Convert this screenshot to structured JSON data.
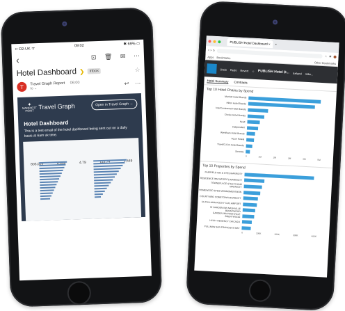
{
  "left_phone": {
    "status_bar": {
      "carrier": "•• O2-UK ᯤ",
      "time": "09:02",
      "battery": "✱ 69% ▭"
    },
    "toolbar": {
      "back": "‹",
      "archive": "⊡",
      "delete": "🗑",
      "mail": "✉",
      "more": "⋯"
    },
    "subject": "Hotel Dashboard",
    "label": "Inbox",
    "sender": {
      "initial": "T",
      "name": "Travel Graph Report",
      "time": "06:00",
      "to": "to ⌄"
    },
    "banner": {
      "logo_text": "MARRIOTT\nPOINT",
      "brand": "Travel Graph",
      "open_button": "Open in Travel Graph →",
      "heading": "Hotel Dashboard",
      "body": "This is a test email of the hotel dashboard being sent out on a daily basis at 6am uk time."
    },
    "kpis": [
      "803,024",
      "6,558",
      "4.79",
      "115.74",
      "1,449"
    ]
  },
  "right_phone": {
    "browser": {
      "tab_title": "PUBLISH Hotel Dashboard",
      "close": "×",
      "new_tab": "+",
      "address": "< > ↻",
      "apps": "Apps",
      "bookmarks": "Bookmarks",
      "other_bookmarks": "Other Bookmarks"
    },
    "app_bar": {
      "undo": "Undo",
      "redo": "Redo",
      "revert": "Revert",
      "title": "PUBLISH Hotel D...",
      "loc": "Iceland",
      "user": "mike..."
    },
    "tabs": [
      "Hotel Summary",
      "Contracts"
    ],
    "chart1_title": "Top 10 Hotel Chains by Spend",
    "chart2_title": "Top 10 Properties by Spend"
  },
  "chart_data": [
    {
      "type": "bar",
      "title": "Top 10 Hotel Chains by Spend",
      "categories": [
        "Marriott Hotel Brands",
        "Hilton Hotel Brands",
        "InterContinental Hotel Brands",
        "Choice Hotel Brands",
        "Hyatt",
        "Independent",
        "Wyndham Hotel Brands",
        "Accor Hotels",
        "TravelCLICK Hotel Brands",
        "Sonesta"
      ],
      "values": [
        5.0,
        4.6,
        1.4,
        1.15,
        0.85,
        0.75,
        0.6,
        0.55,
        0.42,
        0.3
      ],
      "xticks": [
        "0",
        "1M",
        "2M",
        "3M",
        "4M",
        "5M"
      ],
      "xlim": [
        0,
        5.2
      ]
    },
    {
      "type": "bar",
      "title": "Top 10 Properties by Spend",
      "categories": [
        "FAIRFIELD INN & STES MARRIOTT",
        "RESIDENCE INN WATERTS MARRIOTT",
        "TOWNEPLACE STES THUNB MARRIOTT",
        "HOMEWOOD STES MONMOMENTMON",
        "COURTYARD COMETOWN MARRIOTT",
        "FA PULLMAN ROCKY CUG AIRPORT",
        "GI GARDEN INN NASHVILLE BRENTWOOD",
        "GARDEN INN NASHVILLE BRENTWOOD",
        "HYATT REGENCY CHICAGO",
        "PULLMAN SAN FRANCISCO BAY"
      ],
      "values": [
        380,
        110,
        100,
        90,
        80,
        75,
        70,
        65,
        55,
        50
      ],
      "xticks": [
        "0",
        "100K",
        "200K",
        "300K",
        "400K"
      ],
      "xlim": [
        0,
        410
      ]
    }
  ]
}
